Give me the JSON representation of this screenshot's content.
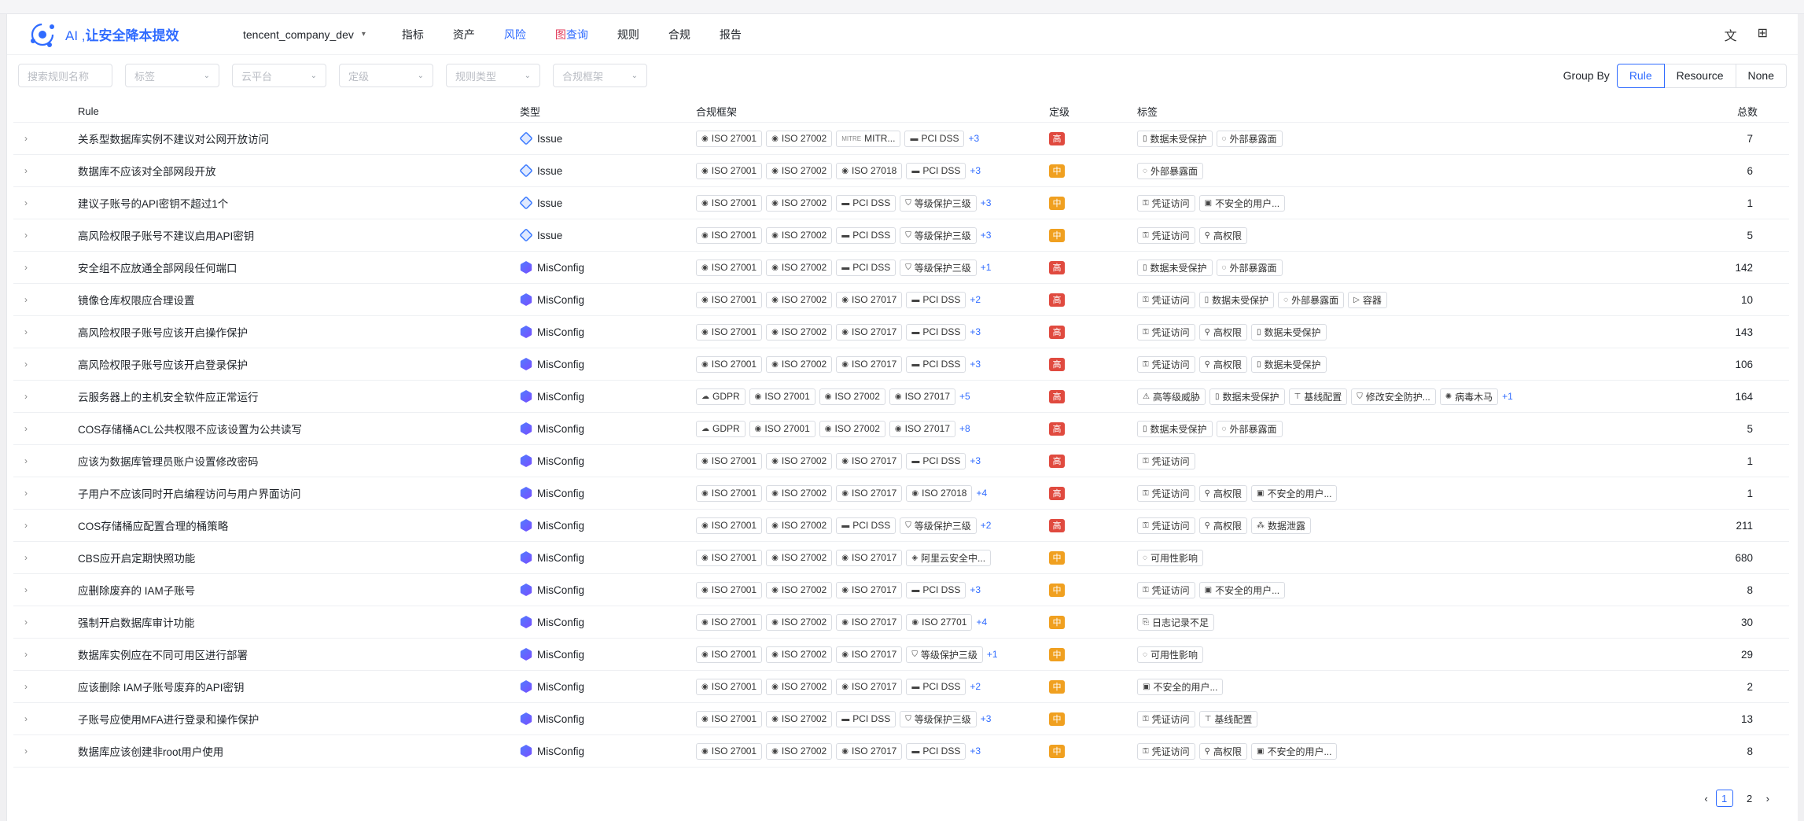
{
  "brand": {
    "ai": "AI ,",
    "name": "让安全降本提效"
  },
  "env": {
    "name": "tencent_company_dev"
  },
  "nav": [
    "指标",
    "资产",
    "风险",
    "图查询",
    "规则",
    "合规",
    "报告"
  ],
  "nav_active": "风险",
  "filters": {
    "search_placeholder": "搜索规则名称",
    "tag": "标签",
    "cloud": "云平台",
    "level": "定级",
    "rule_type": "规则类型",
    "framework": "合规框架"
  },
  "groupby": {
    "label": "Group By",
    "options": [
      "Rule",
      "Resource",
      "None"
    ],
    "active": "Rule"
  },
  "columns": {
    "rule": "Rule",
    "type": "类型",
    "compliance": "合规框架",
    "level": "定级",
    "tags": "标签",
    "total": "总数"
  },
  "rows": [
    {
      "rule": "关系型数据库实例不建议对公网开放访问",
      "type": "Issue",
      "comp": [
        "ISO 27001",
        "ISO 27002",
        "MITR...",
        "PCI DSS"
      ],
      "more": "+3",
      "level": "高",
      "tags": [
        "数据未受保护",
        "外部暴露面"
      ],
      "tag_more": "",
      "total": "7"
    },
    {
      "rule": "数据库不应该对全部网段开放",
      "type": "Issue",
      "comp": [
        "ISO 27001",
        "ISO 27002",
        "ISO 27018",
        "PCI DSS"
      ],
      "more": "+3",
      "level": "中",
      "tags": [
        "外部暴露面"
      ],
      "tag_more": "",
      "total": "6"
    },
    {
      "rule": "建议子账号的API密钥不超过1个",
      "type": "Issue",
      "comp": [
        "ISO 27001",
        "ISO 27002",
        "PCI DSS",
        "等级保护三级"
      ],
      "more": "+3",
      "level": "中",
      "tags": [
        "凭证访问",
        "不安全的用户..."
      ],
      "tag_more": "",
      "total": "1"
    },
    {
      "rule": "高风险权限子账号不建议启用API密钥",
      "type": "Issue",
      "comp": [
        "ISO 27001",
        "ISO 27002",
        "PCI DSS",
        "等级保护三级"
      ],
      "more": "+3",
      "level": "中",
      "tags": [
        "凭证访问",
        "高权限"
      ],
      "tag_more": "",
      "total": "5"
    },
    {
      "rule": "安全组不应放通全部网段任何端口",
      "type": "MisConfig",
      "comp": [
        "ISO 27001",
        "ISO 27002",
        "PCI DSS",
        "等级保护三级"
      ],
      "more": "+1",
      "level": "高",
      "tags": [
        "数据未受保护",
        "外部暴露面"
      ],
      "tag_more": "",
      "total": "142"
    },
    {
      "rule": "镜像仓库权限应合理设置",
      "type": "MisConfig",
      "comp": [
        "ISO 27001",
        "ISO 27002",
        "ISO 27017",
        "PCI DSS"
      ],
      "more": "+2",
      "level": "高",
      "tags": [
        "凭证访问",
        "数据未受保护",
        "外部暴露面",
        "容器"
      ],
      "tag_more": "",
      "total": "10"
    },
    {
      "rule": "高风险权限子账号应该开启操作保护",
      "type": "MisConfig",
      "comp": [
        "ISO 27001",
        "ISO 27002",
        "ISO 27017",
        "PCI DSS"
      ],
      "more": "+3",
      "level": "高",
      "tags": [
        "凭证访问",
        "高权限",
        "数据未受保护"
      ],
      "tag_more": "",
      "total": "143"
    },
    {
      "rule": "高风险权限子账号应该开启登录保护",
      "type": "MisConfig",
      "comp": [
        "ISO 27001",
        "ISO 27002",
        "ISO 27017",
        "PCI DSS"
      ],
      "more": "+3",
      "level": "高",
      "tags": [
        "凭证访问",
        "高权限",
        "数据未受保护"
      ],
      "tag_more": "",
      "total": "106"
    },
    {
      "rule": "云服务器上的主机安全软件应正常运行",
      "type": "MisConfig",
      "comp": [
        "GDPR",
        "ISO 27001",
        "ISO 27002",
        "ISO 27017"
      ],
      "more": "+5",
      "level": "高",
      "tags": [
        "高等级威胁",
        "数据未受保护",
        "基线配置",
        "修改安全防护...",
        "病毒木马"
      ],
      "tag_more": "+1",
      "total": "164"
    },
    {
      "rule": "COS存储桶ACL公共权限不应该设置为公共读写",
      "type": "MisConfig",
      "comp": [
        "GDPR",
        "ISO 27001",
        "ISO 27002",
        "ISO 27017"
      ],
      "more": "+8",
      "level": "高",
      "tags": [
        "数据未受保护",
        "外部暴露面"
      ],
      "tag_more": "",
      "total": "5"
    },
    {
      "rule": "应该为数据库管理员账户设置修改密码",
      "type": "MisConfig",
      "comp": [
        "ISO 27001",
        "ISO 27002",
        "ISO 27017",
        "PCI DSS"
      ],
      "more": "+3",
      "level": "高",
      "tags": [
        "凭证访问"
      ],
      "tag_more": "",
      "total": "1"
    },
    {
      "rule": "子用户不应该同时开启编程访问与用户界面访问",
      "type": "MisConfig",
      "comp": [
        "ISO 27001",
        "ISO 27002",
        "ISO 27017",
        "ISO 27018"
      ],
      "more": "+4",
      "level": "高",
      "tags": [
        "凭证访问",
        "高权限",
        "不安全的用户..."
      ],
      "tag_more": "",
      "total": "1"
    },
    {
      "rule": "COS存储桶应配置合理的桶策略",
      "type": "MisConfig",
      "comp": [
        "ISO 27001",
        "ISO 27002",
        "PCI DSS",
        "等级保护三级"
      ],
      "more": "+2",
      "level": "高",
      "tags": [
        "凭证访问",
        "高权限",
        "数据泄露"
      ],
      "tag_more": "",
      "total": "211"
    },
    {
      "rule": "CBS应开启定期快照功能",
      "type": "MisConfig",
      "comp": [
        "ISO 27001",
        "ISO 27002",
        "ISO 27017",
        "阿里云安全中..."
      ],
      "more": "",
      "level": "中",
      "tags": [
        "可用性影响"
      ],
      "tag_more": "",
      "total": "680"
    },
    {
      "rule": "应删除废弃的 IAM子账号",
      "type": "MisConfig",
      "comp": [
        "ISO 27001",
        "ISO 27002",
        "ISO 27017",
        "PCI DSS"
      ],
      "more": "+3",
      "level": "中",
      "tags": [
        "凭证访问",
        "不安全的用户..."
      ],
      "tag_more": "",
      "total": "8"
    },
    {
      "rule": "强制开启数据库审计功能",
      "type": "MisConfig",
      "comp": [
        "ISO 27001",
        "ISO 27002",
        "ISO 27017",
        "ISO 27701"
      ],
      "more": "+4",
      "level": "中",
      "tags": [
        "日志记录不足"
      ],
      "tag_more": "",
      "total": "30"
    },
    {
      "rule": "数据库实例应在不同可用区进行部署",
      "type": "MisConfig",
      "comp": [
        "ISO 27001",
        "ISO 27002",
        "ISO 27017",
        "等级保护三级"
      ],
      "more": "+1",
      "level": "中",
      "tags": [
        "可用性影响"
      ],
      "tag_more": "",
      "total": "29"
    },
    {
      "rule": "应该删除 IAM子账号废弃的API密钥",
      "type": "MisConfig",
      "comp": [
        "ISO 27001",
        "ISO 27002",
        "ISO 27017",
        "PCI DSS"
      ],
      "more": "+2",
      "level": "中",
      "tags": [
        "不安全的用户..."
      ],
      "tag_more": "",
      "total": "2"
    },
    {
      "rule": "子账号应使用MFA进行登录和操作保护",
      "type": "MisConfig",
      "comp": [
        "ISO 27001",
        "ISO 27002",
        "PCI DSS",
        "等级保护三级"
      ],
      "more": "+3",
      "level": "中",
      "tags": [
        "凭证访问",
        "基线配置"
      ],
      "tag_more": "",
      "total": "13"
    },
    {
      "rule": "数据库应该创建非root用户使用",
      "type": "MisConfig",
      "comp": [
        "ISO 27001",
        "ISO 27002",
        "ISO 27017",
        "PCI DSS"
      ],
      "more": "+3",
      "level": "中",
      "tags": [
        "凭证访问",
        "高权限",
        "不安全的用户..."
      ],
      "tag_more": "",
      "total": "8"
    }
  ],
  "pagination": {
    "prev": "‹",
    "pages": [
      "1",
      "2"
    ],
    "active": "1",
    "next": "›"
  }
}
